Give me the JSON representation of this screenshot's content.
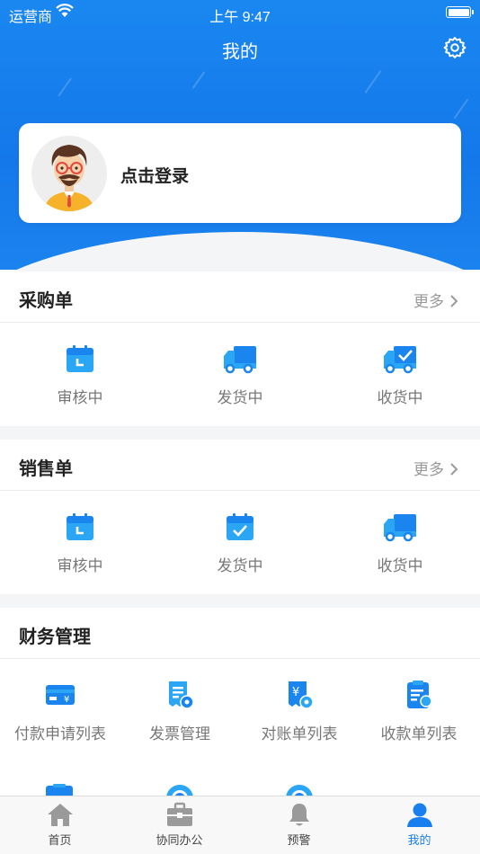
{
  "status_bar": {
    "carrier": "运营商",
    "time": "上午 9:47"
  },
  "nav": {
    "title": "我的"
  },
  "user": {
    "login_label": "点击登录"
  },
  "purchase": {
    "title": "采购单",
    "more": "更多",
    "items": [
      {
        "label": "审核中",
        "icon": "calendar-clock-icon"
      },
      {
        "label": "发货中",
        "icon": "truck-icon"
      },
      {
        "label": "收货中",
        "icon": "truck-check-icon"
      }
    ]
  },
  "sales": {
    "title": "销售单",
    "more": "更多",
    "items": [
      {
        "label": "审核中",
        "icon": "calendar-clock-icon"
      },
      {
        "label": "发货中",
        "icon": "calendar-check-icon"
      },
      {
        "label": "收货中",
        "icon": "truck-icon"
      }
    ]
  },
  "finance": {
    "title": "财务管理",
    "items": [
      {
        "label": "付款申请列表",
        "icon": "card-yen-icon"
      },
      {
        "label": "发票管理",
        "icon": "invoice-gear-icon"
      },
      {
        "label": "对账单列表",
        "icon": "yen-receipt-gear-icon"
      },
      {
        "label": "收款单列表",
        "icon": "clipboard-coin-icon"
      }
    ]
  },
  "tabs": [
    {
      "label": "首页",
      "icon": "home-icon"
    },
    {
      "label": "协同办公",
      "icon": "briefcase-icon"
    },
    {
      "label": "预警",
      "icon": "bell-icon"
    },
    {
      "label": "我的",
      "icon": "person-icon",
      "active": true
    }
  ],
  "colors": {
    "primary": "#1a7fee",
    "icon_light": "#2bb0f5"
  }
}
